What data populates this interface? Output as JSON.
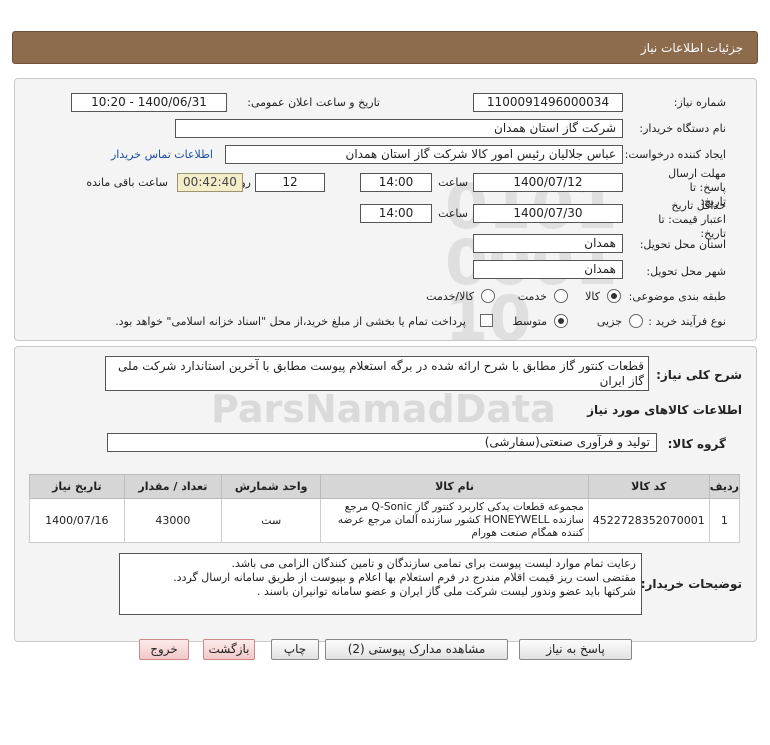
{
  "header": {
    "title": "جزئیات اطلاعات نیاز"
  },
  "form": {
    "need_number_label": "شماره نیاز:",
    "need_number": "1100091496000034",
    "announce_label": "تاریخ و ساعت اعلان عمومی:",
    "announce_value": "1400/06/31 - 10:20",
    "buyer_org_label": "نام دستگاه خریدار:",
    "buyer_org": "شرکت گاز استان همدان",
    "requester_label": "ایجاد کننده درخواست:",
    "requester": "عباس جلالیان رئیس امور کالا شرکت گاز استان همدان",
    "contact_link": "اطلاعات تماس خریدار",
    "reply_deadline_label": "مهلت ارسال پاسخ: تا تاریخ:",
    "reply_date": "1400/07/12",
    "time_label": "ساعت",
    "reply_time": "14:00",
    "days_value": "12",
    "days_label": "روز و",
    "remaining_time": "00:42:40",
    "remaining_label": "ساعت باقی مانده",
    "validity_label": "حداقل تاریخ اعتبار قیمت: تا تاریخ:",
    "validity_date": "1400/07/30",
    "validity_time": "14:00",
    "province_label": "استان محل تحویل:",
    "province": "همدان",
    "city_label": "شهر محل تحویل:",
    "city": "همدان",
    "category_label": "طبقه بندی موضوعی:",
    "category_options": [
      "کالا",
      "خدمت",
      "کالا/خدمت"
    ],
    "process_label": "نوع فرآیند خرید :",
    "process_options": [
      "جزیی",
      "متوسط"
    ],
    "payment_note": "پرداخت تمام یا بخشی از مبلغ خرید،از محل \"اسناد خزانه اسلامی\" خواهد بود."
  },
  "details": {
    "summary_label": "شرح کلی نیاز:",
    "summary": "قطعات کنتور گاز مطابق با شرح ارائه شده در برگه استعلام پیوست مطابق با آخرین استاندارد شرکت ملی گاز ایران",
    "goods_info_title": "اطلاعات کالاهای مورد نیاز",
    "goods_group_label": "گروه کالا:",
    "goods_group": "تولید و فرآوری صنعتی(سفارشی)",
    "table": {
      "headers": [
        "ردیف",
        "کد کالا",
        "نام کالا",
        "واحد شمارش",
        "تعداد / مقدار",
        "تاریخ نیاز"
      ],
      "rows": [
        {
          "row": "1",
          "code": "4522728352070001",
          "name": "مجموعه قطعات یدکی کاربرد کنتور گاز Q-Sonic مرجع سازنده HONEYWELL کشور سازنده آلمان مرجع عرضه کننده همگام صنعت هورام",
          "unit": "ست",
          "qty": "43000",
          "date": "1400/07/16"
        }
      ]
    },
    "buyer_notes_label": "توضیحات خریدار:",
    "buyer_notes": [
      "رعایت تمام موارد لیست پیوست برای تمامی سازندگان و تامین کنندگان الزامی می باشد.",
      "مقتضی است ریز قیمت اقلام مندرج در فرم استعلام بها اعلام و بپیوست از طریق سامانه ارسال گردد.",
      "شرکتها باید عضو وندور لیست شرکت ملی گاز  ایران و عضو سامانه توانیران باسند ."
    ]
  },
  "buttons": {
    "reply": "پاسخ به نیاز",
    "attachments": "مشاهده مدارک پیوستی (2)",
    "print": "چاپ",
    "back": "بازگشت",
    "exit": "خروج"
  }
}
